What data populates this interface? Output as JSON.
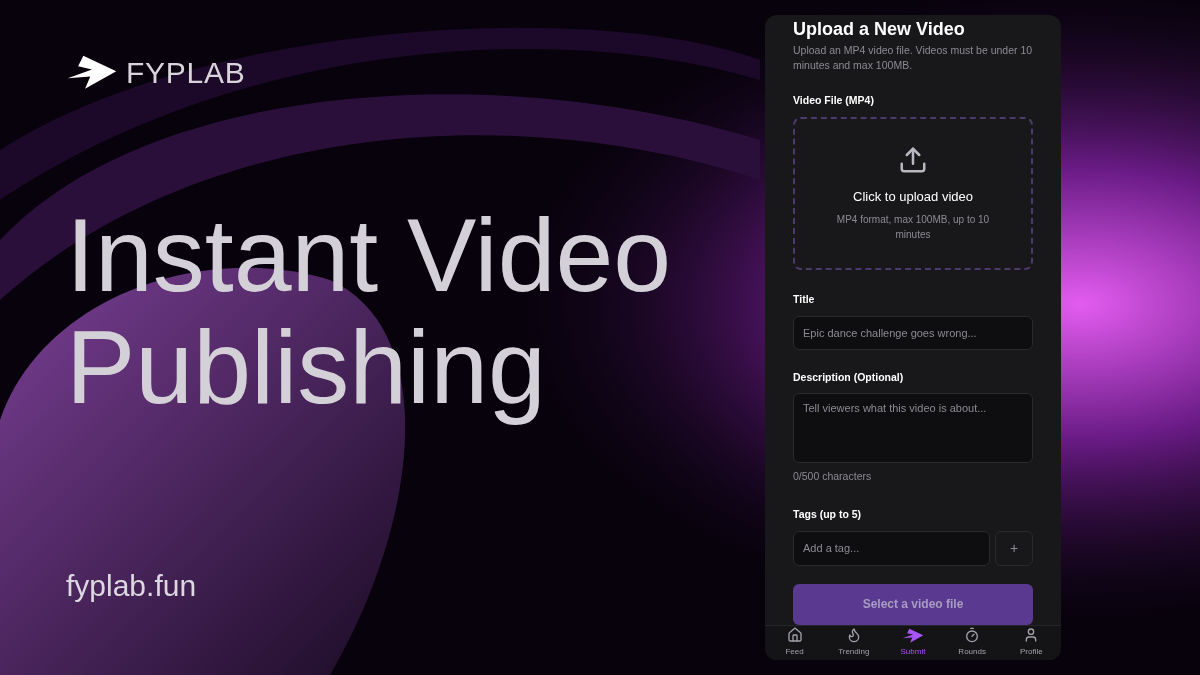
{
  "brand": {
    "name": "FYPLAB"
  },
  "headline": [
    "Instant Video",
    "Publishing"
  ],
  "website": "fyplab.fun",
  "upload_form": {
    "title": "Upload a New Video",
    "subtitle": "Upload an MP4 video file. Videos must be under 10 minutes and max 100MB.",
    "file_label": "Video File (MP4)",
    "dropzone": {
      "title": "Click to upload video",
      "hint": "MP4 format, max 100MB, up to 10 minutes"
    },
    "title_field": {
      "label": "Title",
      "placeholder": "Epic dance challenge goes wrong..."
    },
    "description_field": {
      "label": "Description (Optional)",
      "placeholder": "Tell viewers what this video is about...",
      "counter": "0/500 characters"
    },
    "tags_field": {
      "label": "Tags (up to 5)",
      "placeholder": "Add a tag...",
      "add_button": "+"
    },
    "submit_button": {
      "label": "Select a video file",
      "disabled": true
    }
  },
  "nav": [
    {
      "label": "Feed",
      "kind": "home",
      "selected": false
    },
    {
      "label": "Trending",
      "kind": "flame",
      "selected": false
    },
    {
      "label": "Submit",
      "kind": "logo",
      "selected": true
    },
    {
      "label": "Rounds",
      "kind": "timer",
      "selected": false
    },
    {
      "label": "Profile",
      "kind": "user",
      "selected": false
    }
  ]
}
